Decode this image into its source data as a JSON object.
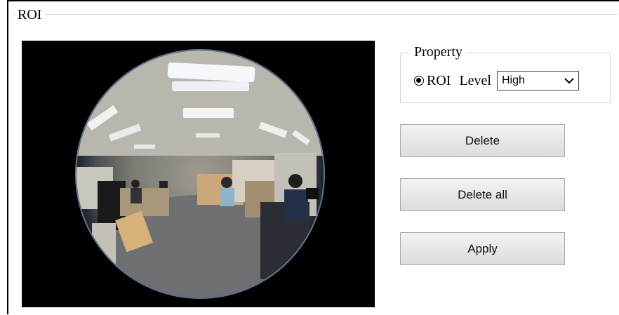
{
  "section": {
    "legend": "ROI"
  },
  "property": {
    "legend": "Property",
    "radio_label": "ROI",
    "level_label": "Level",
    "level_selected": "High"
  },
  "buttons": {
    "delete": "Delete",
    "delete_all": "Delete all",
    "apply": "Apply"
  },
  "icons": {
    "dropdown": "chevron-down-icon",
    "radio": "radio-selected-icon"
  },
  "colors": {
    "preview_bg": "#000000",
    "button_border": "#a9a9a9"
  }
}
